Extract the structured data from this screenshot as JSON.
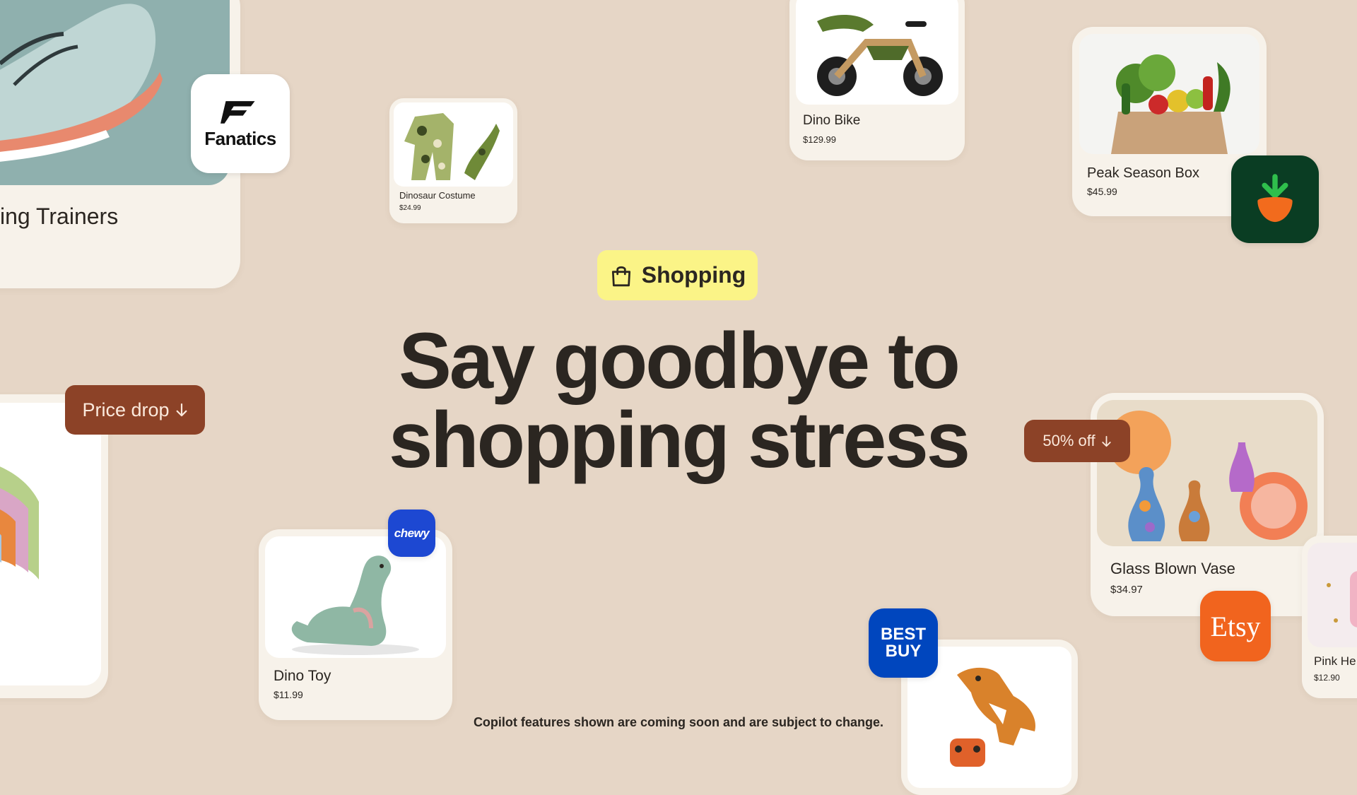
{
  "category_pill": {
    "label": "Shopping",
    "icon": "shopping-bag-icon",
    "color": "#fbf487"
  },
  "headline": {
    "line1": "Say goodbye to",
    "line2": "shopping stress"
  },
  "disclaimer": "Copilot features shown are coming soon and are subject to change.",
  "chips": {
    "price_drop": {
      "label": "Price drop",
      "icon": "arrow-down-icon",
      "color": "#8c4227"
    },
    "discount": {
      "label": "50% off",
      "icon": "arrow-down-icon",
      "color": "#8c4227"
    }
  },
  "products": {
    "trainers": {
      "name": "ing Trainers",
      "image": "running-shoe-image"
    },
    "dino_costume": {
      "name": "Dinosaur Costume",
      "price": "$24.99",
      "image": "dinosaur-costume-image"
    },
    "dino_bike": {
      "name": "Dino Bike",
      "price": "$129.99",
      "image": "dino-bike-image"
    },
    "peak_box": {
      "name": "Peak Season Box",
      "price": "$45.99",
      "image": "grocery-bag-image"
    },
    "dino_toy": {
      "name": "Dino Toy",
      "price": "$11.99",
      "image": "dino-toy-image"
    },
    "glass_vase": {
      "name": "Glass Blown Vase",
      "price": "$34.97",
      "image": "glass-vase-image"
    },
    "pink_item": {
      "name": "Pink He",
      "price": "$12.90",
      "image": "pink-item-image"
    },
    "rc_dino": {
      "image": "rc-dinosaur-image"
    },
    "blanket": {
      "image": "striped-blanket-image"
    }
  },
  "retailers": {
    "fanatics": {
      "label": "Fanatics",
      "color": "#ffffff"
    },
    "instacart": {
      "icon": "carrot-logo-icon",
      "color": "#0a3d23"
    },
    "chewy": {
      "label": "chewy",
      "color": "#1d48d2"
    },
    "bestbuy": {
      "label_line1": "BEST",
      "label_line2": "BUY",
      "color": "#0046be"
    },
    "etsy": {
      "label": "Etsy",
      "color": "#f1641e"
    }
  },
  "colors": {
    "background": "#e6d6c6",
    "card": "#f7f2ea",
    "text": "#2b2621"
  }
}
